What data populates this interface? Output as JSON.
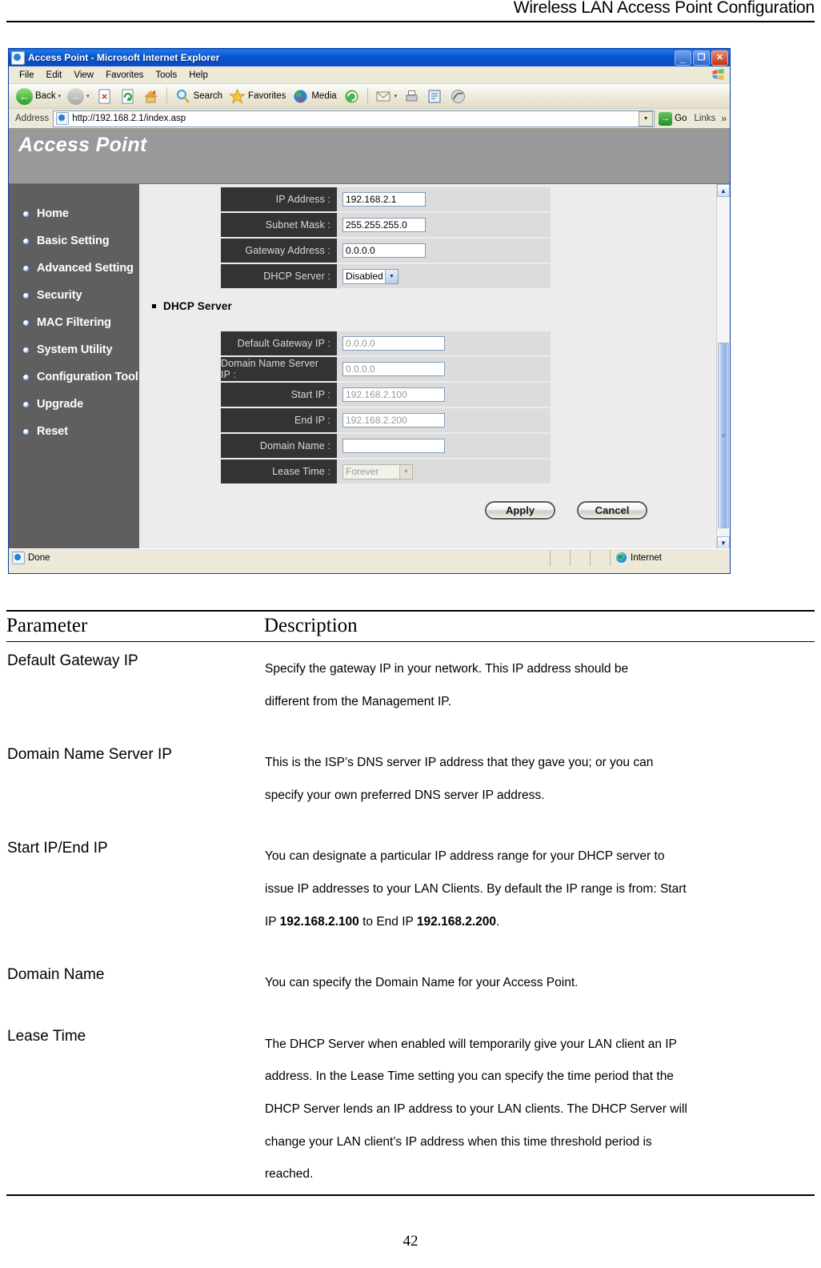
{
  "doc": {
    "running_header": "Wireless LAN Access Point Configuration",
    "page_number": "42"
  },
  "browser": {
    "title": "Access Point - Microsoft Internet Explorer",
    "title_icon": "ie-page-icon",
    "window_buttons": {
      "minimize": "_",
      "restore": "❐",
      "close": "✕"
    },
    "menu": [
      "File",
      "Edit",
      "View",
      "Favorites",
      "Tools",
      "Help"
    ],
    "toolbar": {
      "back": "Back",
      "forward": "",
      "stop": "",
      "refresh": "",
      "home": "",
      "search": "Search",
      "favorites": "Favorites",
      "media": "Media",
      "history": "",
      "mail": "",
      "print": "",
      "edit": "",
      "discuss": "",
      "caret": "▾"
    },
    "address": {
      "label": "Address",
      "url": "http://192.168.2.1/index.asp",
      "go_label": "Go",
      "links_label": "Links",
      "more_chevron": "»",
      "dropdown_arrow": "▾"
    },
    "status": {
      "text": "Done",
      "zone": "Internet"
    },
    "scrollbar": {
      "up_arrow": "▲",
      "down_arrow": "▼",
      "grip": "≡"
    }
  },
  "app": {
    "banner_title": "Access Point",
    "sidebar": {
      "items": [
        {
          "label": "Home"
        },
        {
          "label": "Basic Setting"
        },
        {
          "label": "Advanced Setting"
        },
        {
          "label": "Security"
        },
        {
          "label": "MAC Filtering"
        },
        {
          "label": "System Utility"
        },
        {
          "label": "Configuration Tool"
        },
        {
          "label": "Upgrade"
        },
        {
          "label": "Reset"
        }
      ]
    },
    "lan_form": {
      "rows": [
        {
          "label": "IP Address :",
          "value": "192.168.2.1"
        },
        {
          "label": "Subnet Mask :",
          "value": "255.255.255.0"
        },
        {
          "label": "Gateway Address :",
          "value": "0.0.0.0"
        }
      ],
      "dhcp_server": {
        "label": "DHCP Server :",
        "value": "Disabled"
      }
    },
    "dhcp_section": {
      "title": "DHCP Server",
      "rows": [
        {
          "label": "Default Gateway IP :",
          "value": "0.0.0.0"
        },
        {
          "label": "Domain Name Server IP :",
          "value": "0.0.0.0"
        },
        {
          "label": "Start IP :",
          "value": "192.168.2.100"
        },
        {
          "label": "End IP :",
          "value": "192.168.2.200"
        },
        {
          "label": "Domain Name :",
          "value": ""
        }
      ],
      "lease_time": {
        "label": "Lease Time :",
        "value": "Forever"
      }
    },
    "buttons": {
      "apply": "Apply",
      "cancel": "Cancel"
    }
  },
  "parameter_table": {
    "headers": {
      "parameter": "Parameter",
      "description": "Description"
    },
    "rows": [
      {
        "name": "Default Gateway IP",
        "desc_line1": "Specify the gateway IP in your network. This IP address should be",
        "desc_line2": "different from the Management IP.",
        "desc_line3": "",
        "desc_line4": "",
        "desc_line5": ""
      },
      {
        "name": "Domain Name Server IP",
        "desc_line1": "This is the ISP’s DNS server IP address that they gave you; or you can",
        "desc_line2": "specify your own preferred DNS server IP address.",
        "desc_line3": "",
        "desc_line4": "",
        "desc_line5": ""
      },
      {
        "name": "Start IP/End IP",
        "desc_line1": "You can designate a particular IP address range for your DHCP server to",
        "desc_line2": "issue IP addresses to your LAN Clients. By default the IP range is from: Start",
        "desc_line3_pre": "IP ",
        "desc_line3_b1": "192.168.2.100",
        "desc_line3_mid": " to End IP ",
        "desc_line3_b2": "192.168.2.200",
        "desc_line3_post": ".",
        "desc_line4": "",
        "desc_line5": ""
      },
      {
        "name": "Domain Name",
        "desc_line1": "You can specify the Domain Name for your Access Point.",
        "desc_line2": "",
        "desc_line3": "",
        "desc_line4": "",
        "desc_line5": ""
      },
      {
        "name": "Lease Time",
        "desc_line1": "The DHCP Server when enabled will temporarily give your LAN client an IP",
        "desc_line2": "address. In the Lease Time setting you can specify the time period that the",
        "desc_line3": "DHCP Server lends an IP address to your LAN clients. The DHCP Server will",
        "desc_line4": "change your LAN client’s IP address when this time threshold period is",
        "desc_line5": "reached."
      }
    ]
  },
  "colors": {
    "banner_gray": "#999999",
    "sidebar_gray": "#5f5f5f",
    "label_cell": "#333333",
    "value_cell": "#dcdcdc",
    "content_bg": "#ececec",
    "titlebar_blue": "#0a55cf"
  }
}
